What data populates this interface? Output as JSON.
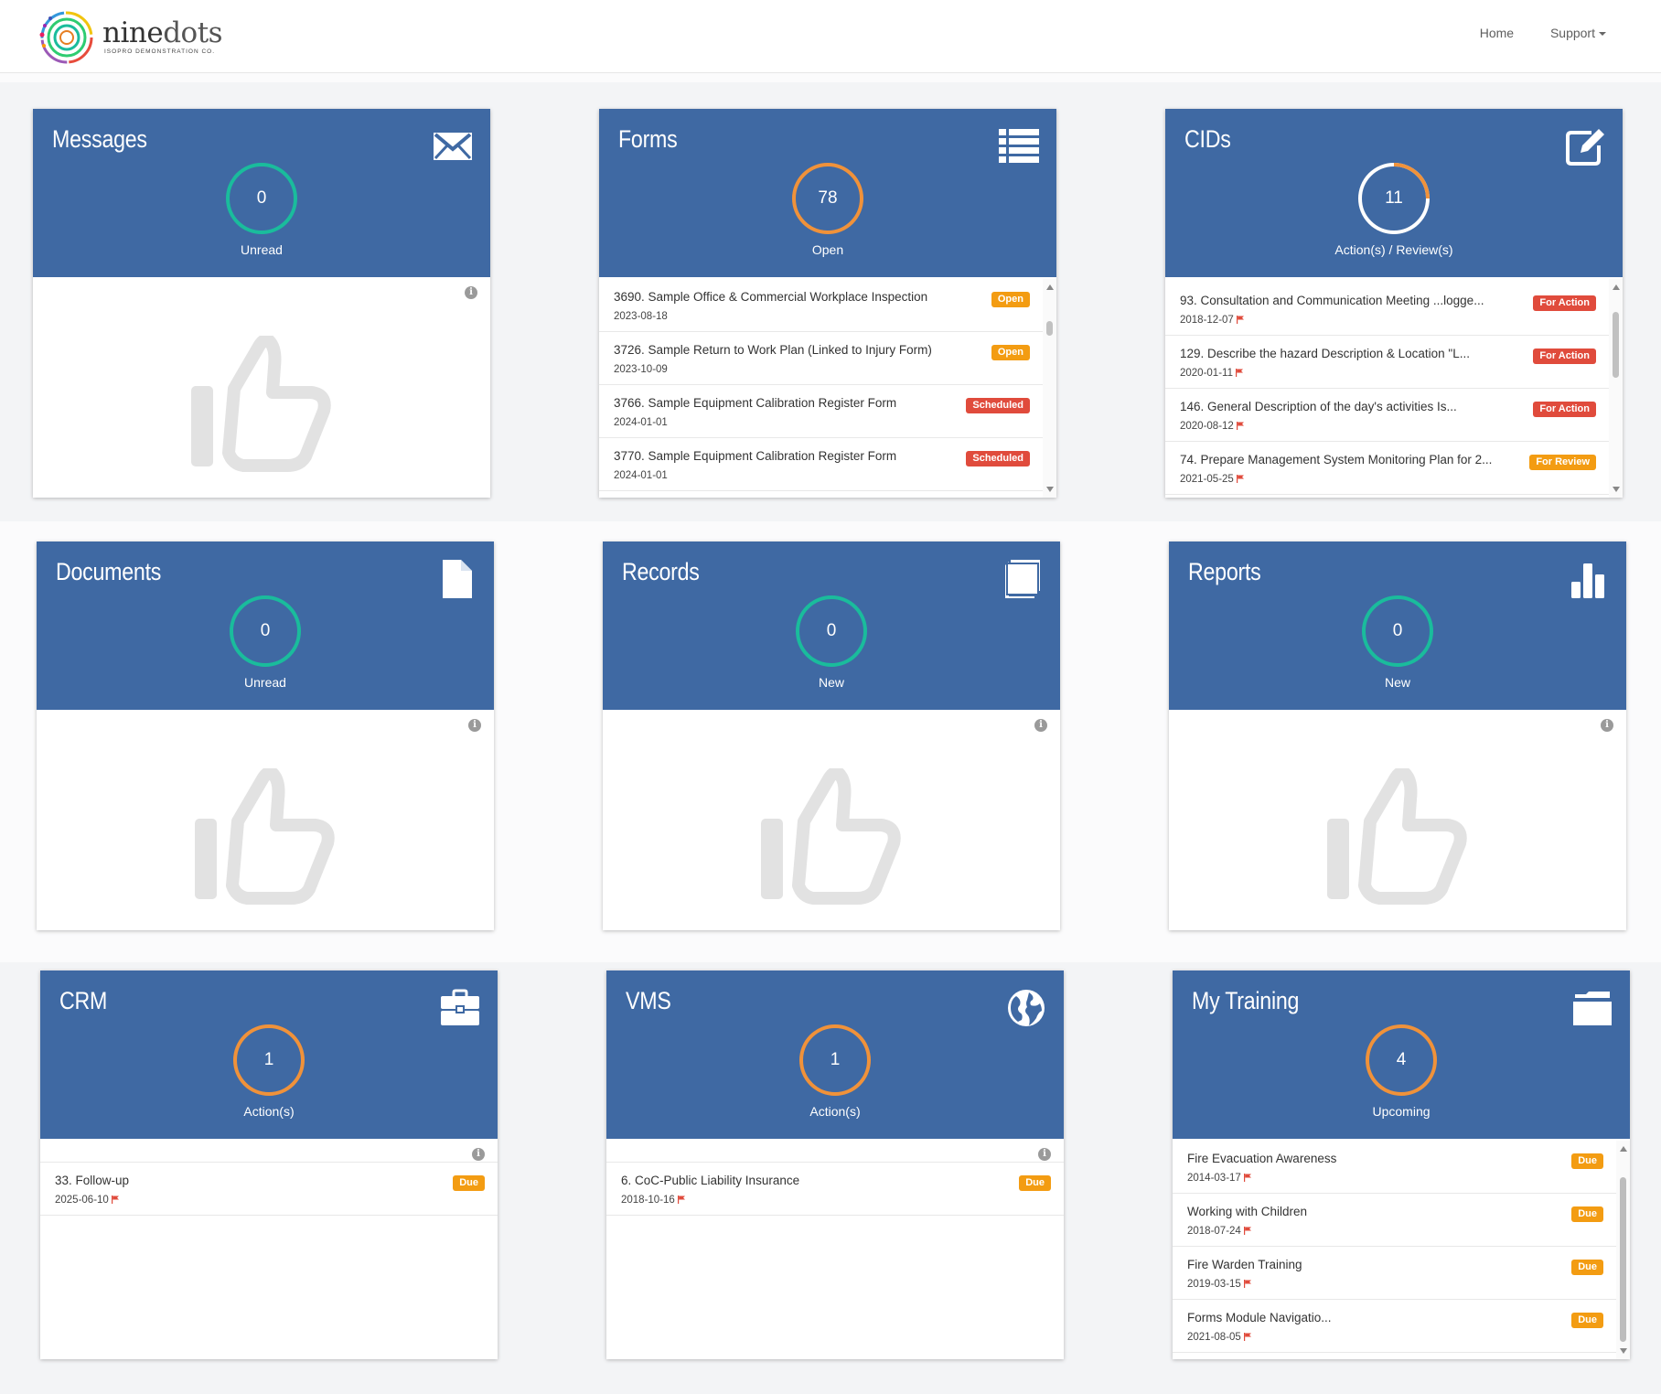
{
  "brand": {
    "name_bold": "nine",
    "name_light": "dots",
    "tagline": "ISOPRO DEMONSTRATION CO."
  },
  "nav": {
    "home": "Home",
    "support": "Support"
  },
  "colors": {
    "header_blue": "#3f69a3",
    "ring_teal": "#1abc9c",
    "ring_orange": "#f0923a",
    "badge_orange": "#f39c12",
    "badge_red": "#e04b3c"
  },
  "cards": {
    "messages": {
      "title": "Messages",
      "count": "0",
      "label": "Unread",
      "icon": "envelope-icon"
    },
    "forms": {
      "title": "Forms",
      "count": "78",
      "label": "Open",
      "icon": "list-icon",
      "items": [
        {
          "title": "3690. Sample Office & Commercial Workplace Inspection",
          "date": "2023-08-18",
          "badge": "Open"
        },
        {
          "title": "3726. Sample Return to Work Plan (Linked to Injury Form)",
          "date": "2023-10-09",
          "badge": "Open"
        },
        {
          "title": "3766. Sample Equipment Calibration Register Form",
          "date": "2024-01-01",
          "badge": "Scheduled"
        },
        {
          "title": "3770. Sample Equipment Calibration Register Form",
          "date": "2024-01-01",
          "badge": "Scheduled"
        }
      ]
    },
    "cids": {
      "title": "CIDs",
      "count": "11",
      "label": "Action(s) / Review(s)",
      "icon": "edit-icon",
      "items": [
        {
          "title": "93. Consultation and Communication Meeting ...logge...",
          "date": "2018-12-07",
          "badge": "For Action"
        },
        {
          "title": "129. Describe the hazard Description & Location \"L...",
          "date": "2020-01-11",
          "badge": "For Action"
        },
        {
          "title": "146. General Description of the day's activities Is...",
          "date": "2020-08-12",
          "badge": "For Action"
        },
        {
          "title": "74. Prepare Management System Monitoring Plan for 2...",
          "date": "2021-05-25",
          "badge": "For Review"
        }
      ]
    },
    "documents": {
      "title": "Documents",
      "count": "0",
      "label": "Unread",
      "icon": "file-icon"
    },
    "records": {
      "title": "Records",
      "count": "0",
      "label": "New",
      "icon": "book-icon"
    },
    "reports": {
      "title": "Reports",
      "count": "0",
      "label": "New",
      "icon": "bar-chart-icon"
    },
    "crm": {
      "title": "CRM",
      "count": "1",
      "label": "Action(s)",
      "icon": "briefcase-icon",
      "items": [
        {
          "title": "33. Follow-up",
          "date": "2025-06-10",
          "badge": "Due"
        }
      ]
    },
    "vms": {
      "title": "VMS",
      "count": "1",
      "label": "Action(s)",
      "icon": "globe-icon",
      "items": [
        {
          "title": "6. CoC-Public Liability Insurance",
          "date": "2018-10-16",
          "badge": "Due"
        }
      ]
    },
    "training": {
      "title": "My Training",
      "count": "4",
      "label": "Upcoming",
      "icon": "folder-icon",
      "items": [
        {
          "title": "Fire Evacuation Awareness",
          "date": "2014-03-17",
          "badge": "Due"
        },
        {
          "title": "Working with Children",
          "date": "2018-07-24",
          "badge": "Due"
        },
        {
          "title": "Fire Warden Training",
          "date": "2019-03-15",
          "badge": "Due"
        },
        {
          "title": "Forms Module Navigatio...",
          "date": "2021-08-05",
          "badge": "Due"
        }
      ]
    }
  }
}
